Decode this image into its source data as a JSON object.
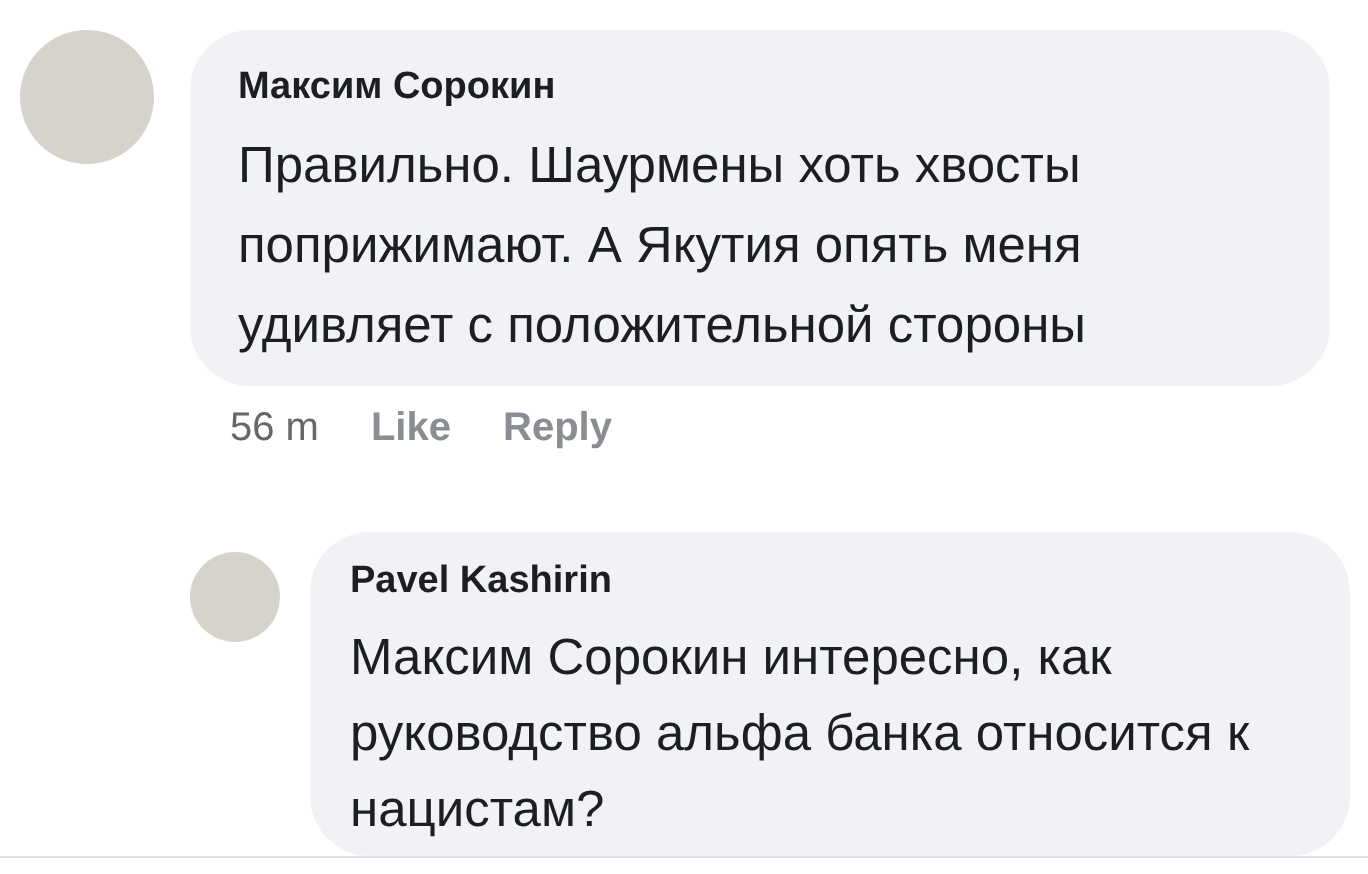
{
  "comments": [
    {
      "author": "Максим Сорокин",
      "text": "Правильно. Шаурмены хоть хвосты поприжимают. А Якутия опять меня удивляет с положительной стороны",
      "time": "56 m",
      "actions": [
        "Like",
        "Reply"
      ]
    }
  ],
  "replies": [
    {
      "author": "Pavel  Kashirin",
      "text": "Максим Сорокин интересно, как руководство альфа банка относится к нацистам?"
    }
  ]
}
